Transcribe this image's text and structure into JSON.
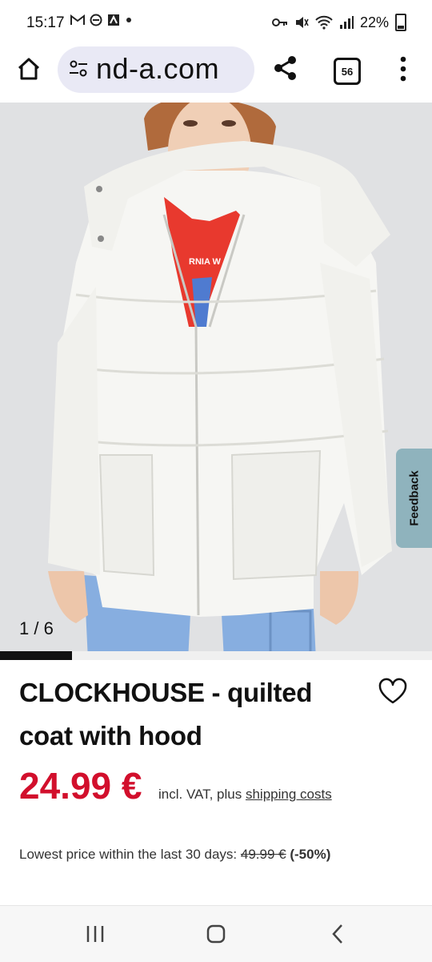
{
  "status_bar": {
    "time": "15:17",
    "battery": "22%",
    "icons": [
      "gmail-icon",
      "vpn-icon",
      "app-icon",
      "dot-icon",
      "key-icon",
      "mute-icon",
      "wifi-icon",
      "signal-icon",
      "battery-icon"
    ]
  },
  "browser": {
    "url": "nd-a.com",
    "tab_count": "56",
    "icons": [
      "home-icon",
      "site-settings-icon",
      "share-icon",
      "tabs-icon",
      "more-icon"
    ]
  },
  "gallery": {
    "counter": "1 / 6",
    "current": 1,
    "total": 6,
    "progress_fraction": 0.1667,
    "shirt_text": "RNIA W"
  },
  "feedback": {
    "label": "Feedback"
  },
  "product": {
    "title": "CLOCKHOUSE - quilted coat with hood",
    "price": "24.99 €",
    "vat_text": "incl. VAT, plus ",
    "shipping_link": "shipping costs",
    "lowest_label": "Lowest price within the last 30 days: ",
    "lowest_old_price": "49.99 €",
    "lowest_discount": "(-50%)",
    "price_color": "#d20f2c"
  },
  "nav": {
    "icons": [
      "recent-apps-icon",
      "home-button-icon",
      "back-icon"
    ]
  },
  "colors": {
    "accent": "#d20f2c",
    "feedback_tab": "#8fb3bd",
    "url_bg": "#e9e9f5"
  }
}
